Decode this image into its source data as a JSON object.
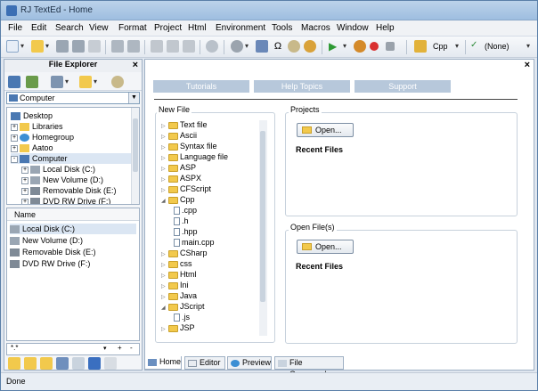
{
  "window": {
    "title": "RJ TextEd - Home"
  },
  "menu": [
    "File",
    "Edit",
    "Search",
    "View",
    "Format",
    "Project",
    "Html",
    "Environment",
    "Tools",
    "Macros",
    "Window",
    "Help"
  ],
  "toolbar": {
    "language": "Cpp",
    "profile": "(None)"
  },
  "file_explorer": {
    "title": "File Explorer",
    "location": "Computer",
    "tree": [
      {
        "label": "Desktop",
        "level": 0,
        "expander": ""
      },
      {
        "label": "Libraries",
        "level": 0,
        "expander": "+"
      },
      {
        "label": "Homegroup",
        "level": 0,
        "expander": "+"
      },
      {
        "label": "Aatoo",
        "level": 0,
        "expander": "+"
      },
      {
        "label": "Computer",
        "level": 0,
        "expander": "-"
      },
      {
        "label": "Local Disk (C:)",
        "level": 1,
        "expander": "+"
      },
      {
        "label": "New Volume (D:)",
        "level": 1,
        "expander": "+"
      },
      {
        "label": "Removable Disk (E:)",
        "level": 1,
        "expander": "+"
      },
      {
        "label": "DVD RW Drive (F:)",
        "level": 1,
        "expander": "+"
      }
    ],
    "list_header": "Name",
    "list": [
      "Local Disk (C:)",
      "New Volume (D:)",
      "Removable Disk (E:)",
      "DVD RW Drive (F:)"
    ],
    "filter": "*.*"
  },
  "home": {
    "nav": [
      "Tutorials",
      "Help Topics",
      "Support"
    ],
    "new_file_label": "New File",
    "new_file_tree": [
      {
        "label": "Text file",
        "level": 0,
        "type": "folder",
        "tw": "▷"
      },
      {
        "label": "Ascii",
        "level": 0,
        "type": "folder",
        "tw": "▷"
      },
      {
        "label": "Syntax file",
        "level": 0,
        "type": "folder",
        "tw": "▷"
      },
      {
        "label": "Language file",
        "level": 0,
        "type": "folder",
        "tw": "▷"
      },
      {
        "label": "ASP",
        "level": 0,
        "type": "folder",
        "tw": "▷"
      },
      {
        "label": "ASPX",
        "level": 0,
        "type": "folder",
        "tw": "▷"
      },
      {
        "label": "CFScript",
        "level": 0,
        "type": "folder",
        "tw": "▷"
      },
      {
        "label": "Cpp",
        "level": 0,
        "type": "folder",
        "tw": "◢"
      },
      {
        "label": ".cpp",
        "level": 1,
        "type": "doc",
        "tw": ""
      },
      {
        "label": ".h",
        "level": 1,
        "type": "doc",
        "tw": ""
      },
      {
        "label": ".hpp",
        "level": 1,
        "type": "doc",
        "tw": ""
      },
      {
        "label": "main.cpp",
        "level": 1,
        "type": "doc",
        "tw": ""
      },
      {
        "label": "CSharp",
        "level": 0,
        "type": "folder",
        "tw": "▷"
      },
      {
        "label": "css",
        "level": 0,
        "type": "folder",
        "tw": "▷"
      },
      {
        "label": "Html",
        "level": 0,
        "type": "folder",
        "tw": "▷"
      },
      {
        "label": "Ini",
        "level": 0,
        "type": "folder",
        "tw": "▷"
      },
      {
        "label": "Java",
        "level": 0,
        "type": "folder",
        "tw": "▷"
      },
      {
        "label": "JScript",
        "level": 0,
        "type": "folder",
        "tw": "◢"
      },
      {
        "label": ".js",
        "level": 1,
        "type": "doc",
        "tw": ""
      },
      {
        "label": "JSP",
        "level": 0,
        "type": "folder",
        "tw": "▷"
      }
    ],
    "projects_label": "Projects",
    "open_files_label": "Open File(s)",
    "open_button": "Open...",
    "recent_files": "Recent Files"
  },
  "tabs": [
    "Home",
    "Editor",
    "Preview",
    "File Commander"
  ],
  "status": "Done"
}
